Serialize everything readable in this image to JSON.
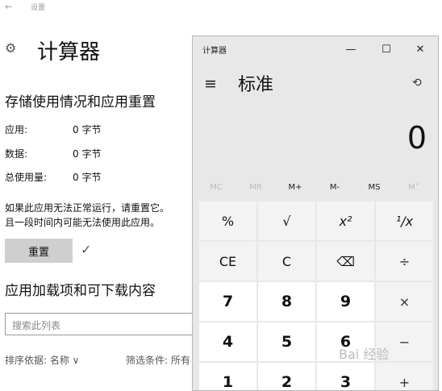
{
  "settings": {
    "back_label": "←",
    "app_title": "设置",
    "page_title": "计算器",
    "storage_heading": "存储使用情况和应用重置",
    "storage_rows": [
      {
        "label": "应用:",
        "value": "0 字节"
      },
      {
        "label": "数据:",
        "value": "0 字节"
      },
      {
        "label": "总使用量:",
        "value": "0 字节"
      }
    ],
    "reset_note_line1": "如果此应用无法正常运行，请重置它。",
    "reset_note_line2": "且一段时间内可能无法使用此应用。",
    "reset_button": "重置",
    "addons_heading": "应用加载项和可下载内容",
    "search_placeholder": "搜索此列表",
    "sort_label": "排序依据: 名称 ∨",
    "filter_label": "筛选条件: 所有"
  },
  "calculator": {
    "window_title": "计算器",
    "minimize": "—",
    "maximize": "☐",
    "close": "✕",
    "menu_icon": "≡",
    "mode": "标准",
    "history_icon": "⟲",
    "display_value": "0",
    "memory": [
      "MC",
      "MR",
      "M+",
      "M-",
      "MS",
      "M˅"
    ],
    "keys": [
      [
        "%",
        "√",
        "x²",
        "¹/x"
      ],
      [
        "CE",
        "C",
        "⌫",
        "÷"
      ],
      [
        "7",
        "8",
        "9",
        "×"
      ],
      [
        "4",
        "5",
        "6",
        "−"
      ],
      [
        "1",
        "2",
        "3",
        "+"
      ]
    ]
  },
  "watermark": "Bai 经验"
}
